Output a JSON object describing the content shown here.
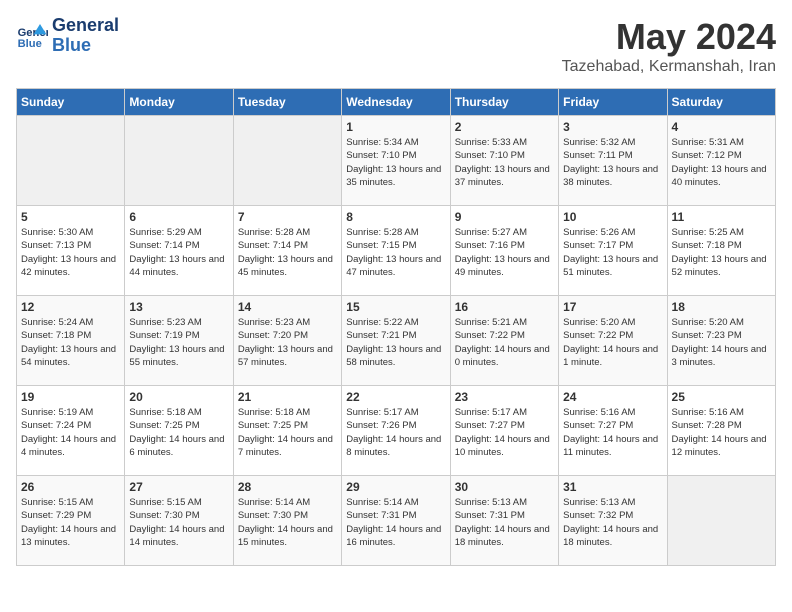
{
  "header": {
    "logo_line1": "General",
    "logo_line2": "Blue",
    "month": "May 2024",
    "location": "Tazehabad, Kermanshah, Iran"
  },
  "weekdays": [
    "Sunday",
    "Monday",
    "Tuesday",
    "Wednesday",
    "Thursday",
    "Friday",
    "Saturday"
  ],
  "weeks": [
    [
      {
        "day": "",
        "empty": true
      },
      {
        "day": "",
        "empty": true
      },
      {
        "day": "",
        "empty": true
      },
      {
        "day": "1",
        "sunrise": "Sunrise: 5:34 AM",
        "sunset": "Sunset: 7:10 PM",
        "daylight": "Daylight: 13 hours and 35 minutes."
      },
      {
        "day": "2",
        "sunrise": "Sunrise: 5:33 AM",
        "sunset": "Sunset: 7:10 PM",
        "daylight": "Daylight: 13 hours and 37 minutes."
      },
      {
        "day": "3",
        "sunrise": "Sunrise: 5:32 AM",
        "sunset": "Sunset: 7:11 PM",
        "daylight": "Daylight: 13 hours and 38 minutes."
      },
      {
        "day": "4",
        "sunrise": "Sunrise: 5:31 AM",
        "sunset": "Sunset: 7:12 PM",
        "daylight": "Daylight: 13 hours and 40 minutes."
      }
    ],
    [
      {
        "day": "5",
        "sunrise": "Sunrise: 5:30 AM",
        "sunset": "Sunset: 7:13 PM",
        "daylight": "Daylight: 13 hours and 42 minutes."
      },
      {
        "day": "6",
        "sunrise": "Sunrise: 5:29 AM",
        "sunset": "Sunset: 7:14 PM",
        "daylight": "Daylight: 13 hours and 44 minutes."
      },
      {
        "day": "7",
        "sunrise": "Sunrise: 5:28 AM",
        "sunset": "Sunset: 7:14 PM",
        "daylight": "Daylight: 13 hours and 45 minutes."
      },
      {
        "day": "8",
        "sunrise": "Sunrise: 5:28 AM",
        "sunset": "Sunset: 7:15 PM",
        "daylight": "Daylight: 13 hours and 47 minutes."
      },
      {
        "day": "9",
        "sunrise": "Sunrise: 5:27 AM",
        "sunset": "Sunset: 7:16 PM",
        "daylight": "Daylight: 13 hours and 49 minutes."
      },
      {
        "day": "10",
        "sunrise": "Sunrise: 5:26 AM",
        "sunset": "Sunset: 7:17 PM",
        "daylight": "Daylight: 13 hours and 51 minutes."
      },
      {
        "day": "11",
        "sunrise": "Sunrise: 5:25 AM",
        "sunset": "Sunset: 7:18 PM",
        "daylight": "Daylight: 13 hours and 52 minutes."
      }
    ],
    [
      {
        "day": "12",
        "sunrise": "Sunrise: 5:24 AM",
        "sunset": "Sunset: 7:18 PM",
        "daylight": "Daylight: 13 hours and 54 minutes."
      },
      {
        "day": "13",
        "sunrise": "Sunrise: 5:23 AM",
        "sunset": "Sunset: 7:19 PM",
        "daylight": "Daylight: 13 hours and 55 minutes."
      },
      {
        "day": "14",
        "sunrise": "Sunrise: 5:23 AM",
        "sunset": "Sunset: 7:20 PM",
        "daylight": "Daylight: 13 hours and 57 minutes."
      },
      {
        "day": "15",
        "sunrise": "Sunrise: 5:22 AM",
        "sunset": "Sunset: 7:21 PM",
        "daylight": "Daylight: 13 hours and 58 minutes."
      },
      {
        "day": "16",
        "sunrise": "Sunrise: 5:21 AM",
        "sunset": "Sunset: 7:22 PM",
        "daylight": "Daylight: 14 hours and 0 minutes."
      },
      {
        "day": "17",
        "sunrise": "Sunrise: 5:20 AM",
        "sunset": "Sunset: 7:22 PM",
        "daylight": "Daylight: 14 hours and 1 minute."
      },
      {
        "day": "18",
        "sunrise": "Sunrise: 5:20 AM",
        "sunset": "Sunset: 7:23 PM",
        "daylight": "Daylight: 14 hours and 3 minutes."
      }
    ],
    [
      {
        "day": "19",
        "sunrise": "Sunrise: 5:19 AM",
        "sunset": "Sunset: 7:24 PM",
        "daylight": "Daylight: 14 hours and 4 minutes."
      },
      {
        "day": "20",
        "sunrise": "Sunrise: 5:18 AM",
        "sunset": "Sunset: 7:25 PM",
        "daylight": "Daylight: 14 hours and 6 minutes."
      },
      {
        "day": "21",
        "sunrise": "Sunrise: 5:18 AM",
        "sunset": "Sunset: 7:25 PM",
        "daylight": "Daylight: 14 hours and 7 minutes."
      },
      {
        "day": "22",
        "sunrise": "Sunrise: 5:17 AM",
        "sunset": "Sunset: 7:26 PM",
        "daylight": "Daylight: 14 hours and 8 minutes."
      },
      {
        "day": "23",
        "sunrise": "Sunrise: 5:17 AM",
        "sunset": "Sunset: 7:27 PM",
        "daylight": "Daylight: 14 hours and 10 minutes."
      },
      {
        "day": "24",
        "sunrise": "Sunrise: 5:16 AM",
        "sunset": "Sunset: 7:27 PM",
        "daylight": "Daylight: 14 hours and 11 minutes."
      },
      {
        "day": "25",
        "sunrise": "Sunrise: 5:16 AM",
        "sunset": "Sunset: 7:28 PM",
        "daylight": "Daylight: 14 hours and 12 minutes."
      }
    ],
    [
      {
        "day": "26",
        "sunrise": "Sunrise: 5:15 AM",
        "sunset": "Sunset: 7:29 PM",
        "daylight": "Daylight: 14 hours and 13 minutes."
      },
      {
        "day": "27",
        "sunrise": "Sunrise: 5:15 AM",
        "sunset": "Sunset: 7:30 PM",
        "daylight": "Daylight: 14 hours and 14 minutes."
      },
      {
        "day": "28",
        "sunrise": "Sunrise: 5:14 AM",
        "sunset": "Sunset: 7:30 PM",
        "daylight": "Daylight: 14 hours and 15 minutes."
      },
      {
        "day": "29",
        "sunrise": "Sunrise: 5:14 AM",
        "sunset": "Sunset: 7:31 PM",
        "daylight": "Daylight: 14 hours and 16 minutes."
      },
      {
        "day": "30",
        "sunrise": "Sunrise: 5:13 AM",
        "sunset": "Sunset: 7:31 PM",
        "daylight": "Daylight: 14 hours and 18 minutes."
      },
      {
        "day": "31",
        "sunrise": "Sunrise: 5:13 AM",
        "sunset": "Sunset: 7:32 PM",
        "daylight": "Daylight: 14 hours and 18 minutes."
      },
      {
        "day": "",
        "empty": true
      }
    ]
  ]
}
